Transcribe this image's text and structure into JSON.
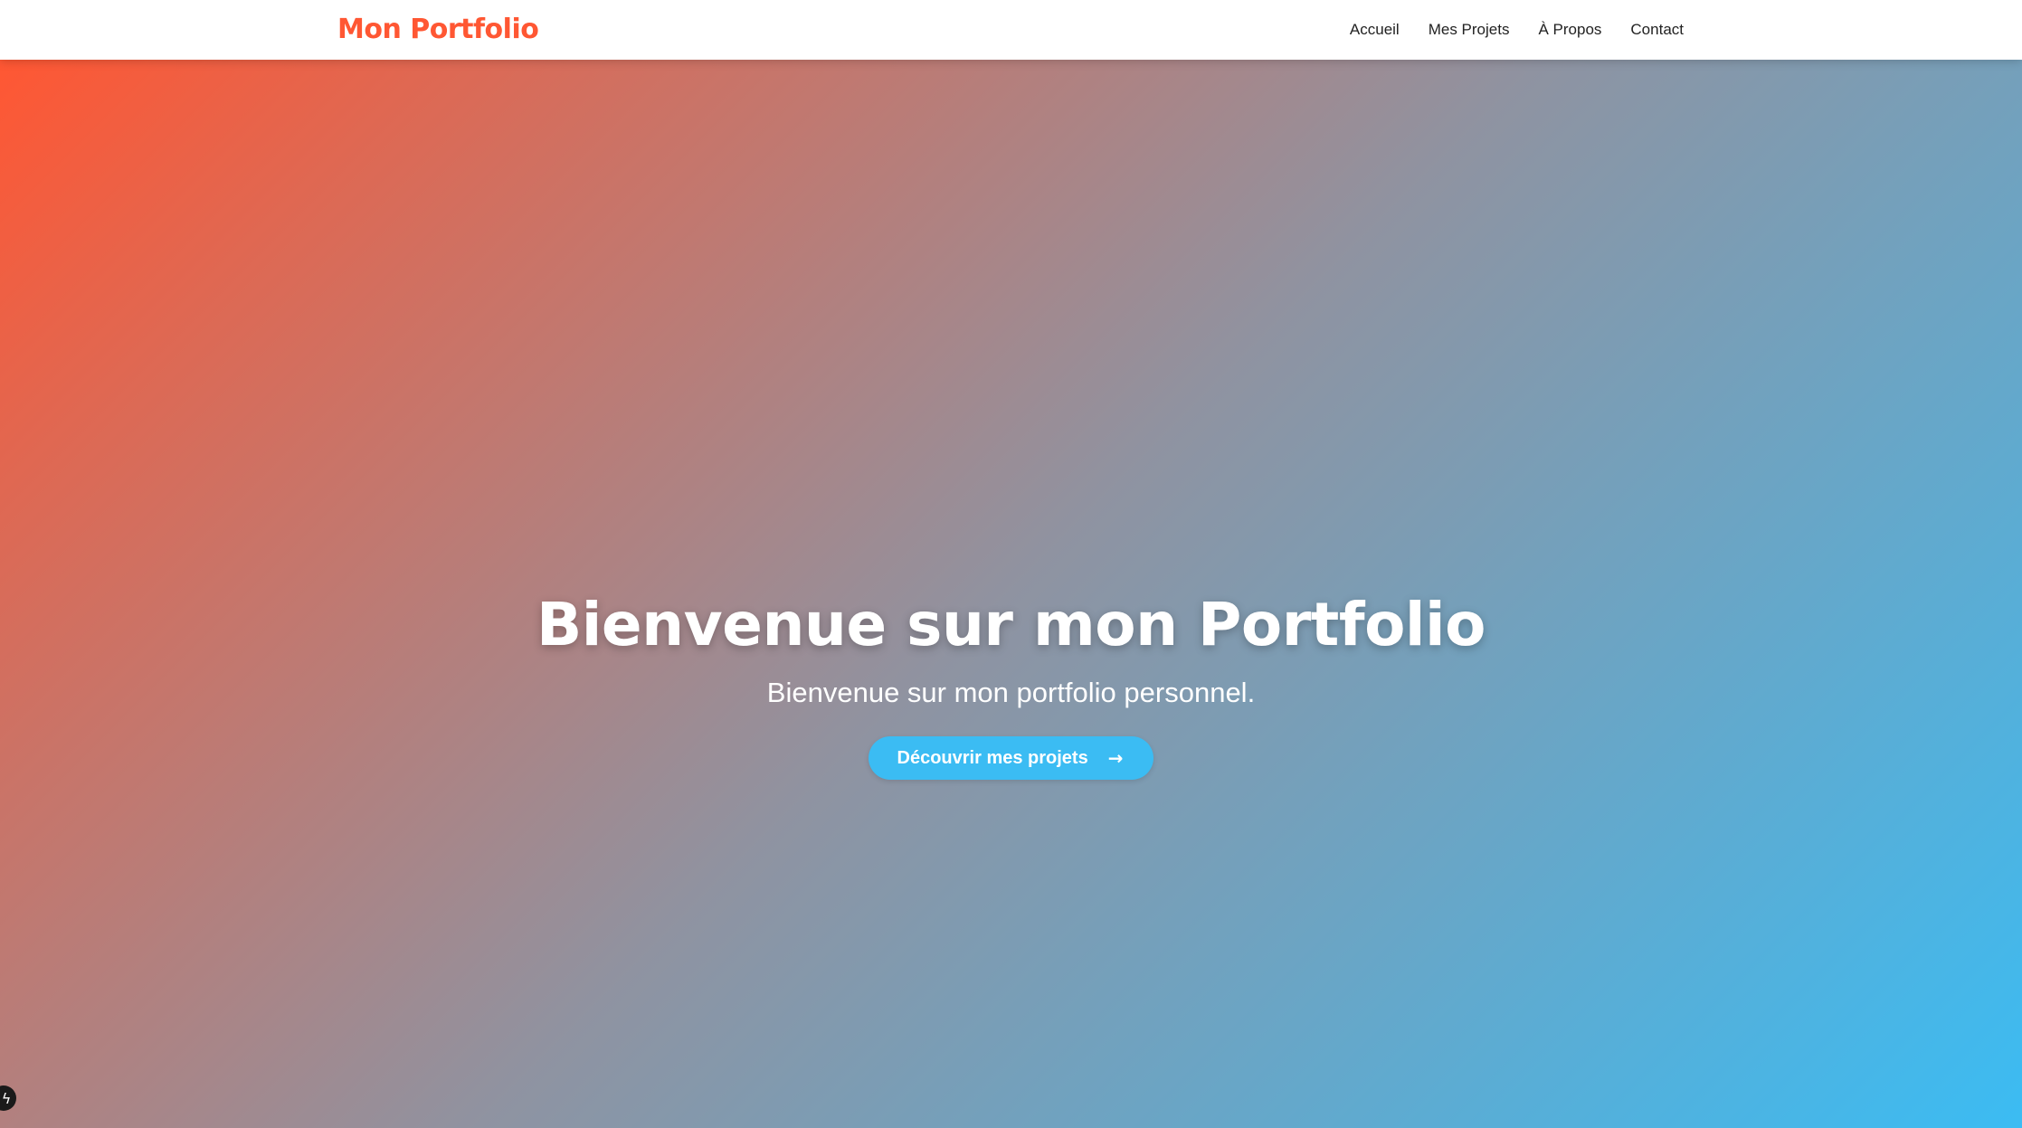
{
  "header": {
    "brand": "Mon Portfolio",
    "nav": [
      {
        "label": "Accueil"
      },
      {
        "label": "Mes Projets"
      },
      {
        "label": "À Propos"
      },
      {
        "label": "Contact"
      }
    ]
  },
  "hero": {
    "title": "Bienvenue sur mon Portfolio",
    "subtitle": "Bienvenue sur mon portfolio personnel.",
    "cta_label": "Découvrir mes projets",
    "cta_icon": "arrow-right-icon"
  },
  "corner_badge": {
    "icon": "bolt-icon"
  },
  "colors": {
    "brand": "#ff5733",
    "gradient_start": "#ff5733",
    "gradient_end": "#3bbcf3",
    "button": "#3bbcf3"
  }
}
